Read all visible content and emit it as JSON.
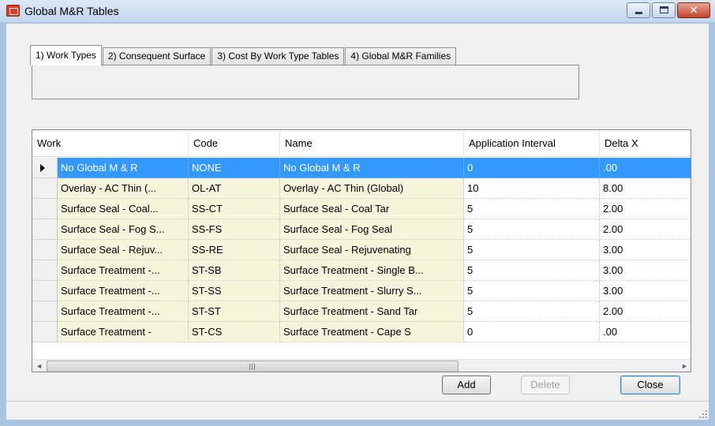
{
  "window": {
    "title": "Global M&R Tables",
    "app_icon": "app-icon",
    "controls": {
      "minimize": "minimize-icon",
      "maximize": "maximize-icon",
      "close_glyph": "✕"
    }
  },
  "tabs": [
    {
      "label": "1) Work Types",
      "active": true
    },
    {
      "label": "2) Consequent Surface",
      "active": false
    },
    {
      "label": "3) Cost By Work Type Tables",
      "active": false
    },
    {
      "label": "4) Global M&R Families",
      "active": false
    }
  ],
  "grid": {
    "columns": [
      "Work",
      "Code",
      "Name",
      "Application Interval",
      "Delta X"
    ],
    "rows": [
      {
        "work": "No Global M & R",
        "code": "NONE",
        "name": "No Global M & R",
        "interval": "0",
        "delta": ".00",
        "selected": true
      },
      {
        "work": "Overlay - AC Thin (...",
        "code": "OL-AT",
        "name": "Overlay - AC Thin (Global)",
        "interval": "10",
        "delta": "8.00"
      },
      {
        "work": "Surface Seal - Coal...",
        "code": "SS-CT",
        "name": "Surface Seal - Coal Tar",
        "interval": "5",
        "delta": "2.00"
      },
      {
        "work": "Surface Seal - Fog S...",
        "code": "SS-FS",
        "name": "Surface Seal - Fog Seal",
        "interval": "5",
        "delta": "2.00"
      },
      {
        "work": "Surface Seal - Rejuv...",
        "code": "SS-RE",
        "name": "Surface Seal - Rejuvenating",
        "interval": "5",
        "delta": "3.00"
      },
      {
        "work": "Surface Treatment -...",
        "code": "ST-SB",
        "name": "Surface Treatment - Single B...",
        "interval": "5",
        "delta": "3.00"
      },
      {
        "work": "Surface Treatment -...",
        "code": "ST-SS",
        "name": "Surface Treatment - Slurry S...",
        "interval": "5",
        "delta": "3.00"
      },
      {
        "work": "Surface Treatment -...",
        "code": "ST-ST",
        "name": "Surface Treatment - Sand Tar",
        "interval": "5",
        "delta": "2.00"
      },
      {
        "work": "Surface Treatment -",
        "code": "ST-CS",
        "name": "Surface Treatment - Cape S",
        "interval": "0",
        "delta": ".00"
      }
    ],
    "scroll": {
      "up": "▲",
      "down": "▼",
      "left": "◄",
      "right": "►"
    }
  },
  "buttons": {
    "add": "Add",
    "delete": "Delete",
    "close": "Close"
  },
  "colors": {
    "selection": "#3399ff",
    "readonly_cell": "#f5f5dc",
    "title_bar": "#c3d6ee"
  }
}
